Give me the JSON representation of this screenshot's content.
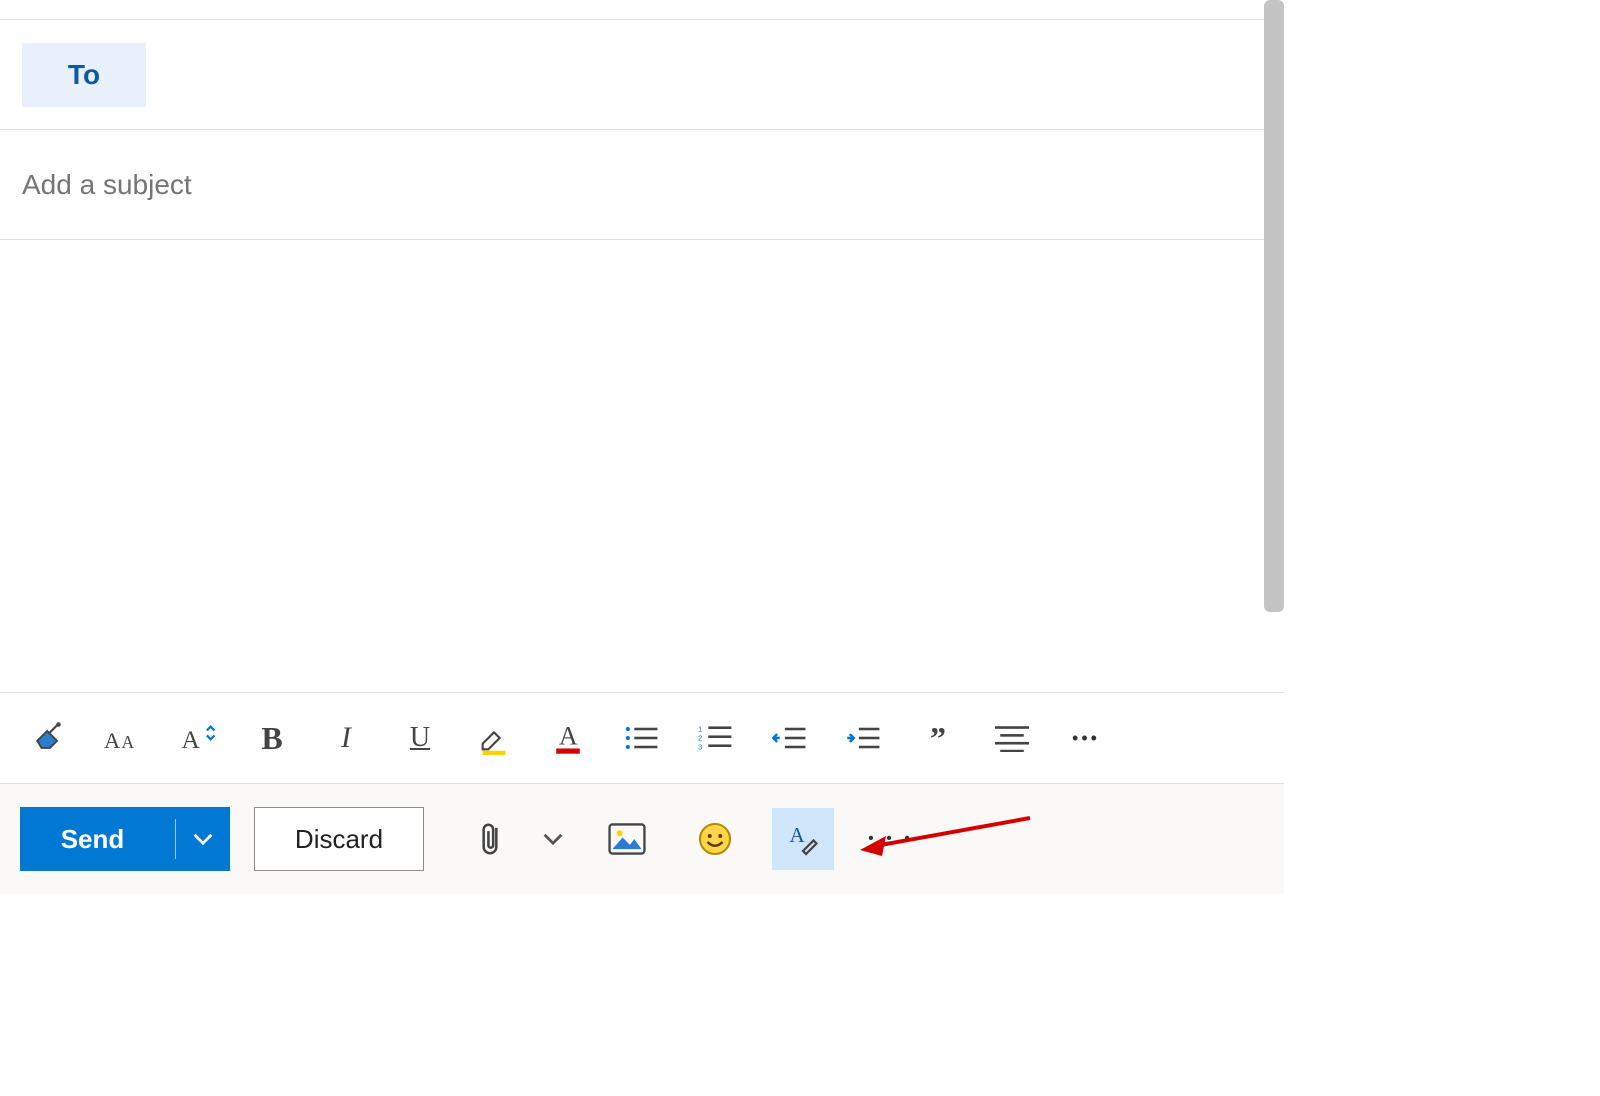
{
  "compose": {
    "to_label": "To",
    "subject_placeholder": "Add a subject"
  },
  "format_toolbar": {
    "items": [
      {
        "name": "format-painter-icon"
      },
      {
        "name": "font-icon"
      },
      {
        "name": "font-size-icon"
      },
      {
        "name": "bold-icon",
        "glyph": "B"
      },
      {
        "name": "italic-icon",
        "glyph": "I"
      },
      {
        "name": "underline-icon",
        "glyph": "U"
      },
      {
        "name": "highlight-icon"
      },
      {
        "name": "font-color-icon",
        "glyph": "A"
      },
      {
        "name": "bullet-list-icon"
      },
      {
        "name": "number-list-icon"
      },
      {
        "name": "decrease-indent-icon"
      },
      {
        "name": "increase-indent-icon"
      },
      {
        "name": "quote-icon",
        "glyph": "”"
      },
      {
        "name": "align-icon"
      },
      {
        "name": "more-format-icon",
        "glyph": "•••"
      }
    ]
  },
  "action_bar": {
    "send_label": "Send",
    "discard_label": "Discard",
    "icons": [
      {
        "name": "attach-icon"
      },
      {
        "name": "attach-dropdown-icon"
      },
      {
        "name": "insert-picture-icon"
      },
      {
        "name": "emoji-icon"
      },
      {
        "name": "signature-icon",
        "active": true
      },
      {
        "name": "more-actions-icon",
        "glyph": "• • •"
      }
    ]
  },
  "annotation": {
    "arrow_color": "#d40000"
  }
}
